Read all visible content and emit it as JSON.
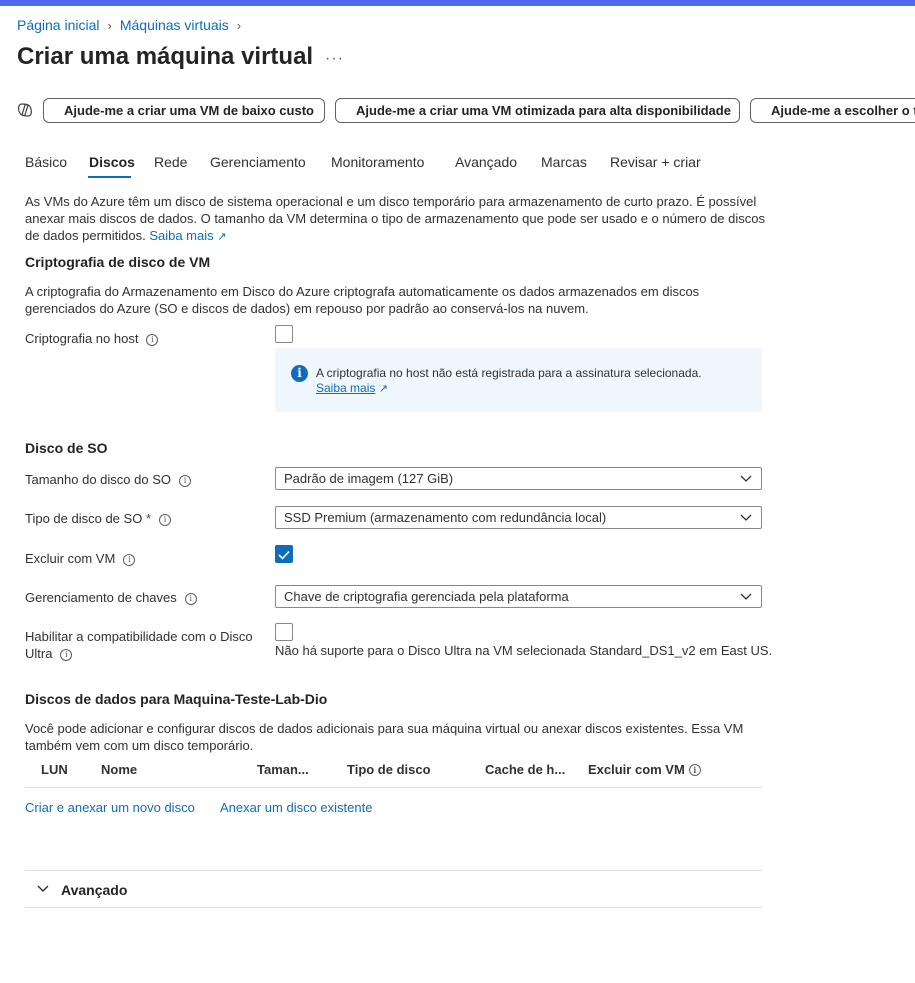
{
  "breadcrumb": {
    "home": "Página inicial",
    "vms": "Máquinas virtuais"
  },
  "title": "Criar uma máquina virtual",
  "more": "···",
  "prompts": [
    "Ajude-me a criar uma VM de baixo custo",
    "Ajude-me a criar uma VM otimizada para alta disponibilidade",
    "Ajude-me a escolher o tamanho"
  ],
  "tabs": [
    "Básico",
    "Discos",
    "Rede",
    "Gerenciamento",
    "Monitoramento",
    "Avançado",
    "Marcas",
    "Revisar + criar"
  ],
  "intro": {
    "text": "As VMs do Azure têm um disco de sistema operacional e um disco temporário para armazenamento de curto prazo. É possível anexar mais discos de dados. O tamanho da VM determina o tipo de armazenamento que pode ser usado e o número de discos de dados permitidos.",
    "link": "Saiba mais"
  },
  "encryption": {
    "heading": "Criptografia de disco de VM",
    "text": "A criptografia do Armazenamento em Disco do Azure criptografa automaticamente os dados armazenados em discos gerenciados do Azure (SO e discos de dados) em repouso por padrão ao conservá-los na nuvem.",
    "host_label": "Criptografia no host",
    "info_message": "A criptografia no host não está registrada para a assinatura selecionada.",
    "info_link": "Saiba mais"
  },
  "os_disk": {
    "heading": "Disco de SO",
    "size_label": "Tamanho do disco do SO",
    "size_value": "Padrão de imagem (127 GiB)",
    "type_label": "Tipo de disco de SO",
    "required_mark": "*",
    "type_value": "SSD Premium (armazenamento com redundância local)",
    "delete_label": "Excluir com VM",
    "delete_checked": true,
    "key_label": "Gerenciamento de chaves",
    "key_value": "Chave de criptografia gerenciada pela plataforma",
    "ultra_label_1": "Habilitar a compatibilidade com o Disco",
    "ultra_label_2": "Ultra",
    "ultra_note": "Não há suporte para o Disco Ultra na VM selecionada Standard_DS1_v2 em East US."
  },
  "data_disks": {
    "heading": "Discos de dados para Maquina-Teste-Lab-Dio",
    "text": "Você pode adicionar e configurar discos de dados adicionais para sua máquina virtual ou anexar discos existentes. Essa VM também vem com um disco temporário.",
    "columns": [
      "LUN",
      "Nome",
      "Taman...",
      "Tipo de disco",
      "Cache de h...",
      "Excluir com VM"
    ],
    "create_link": "Criar e anexar um novo disco",
    "attach_link": "Anexar um disco existente"
  },
  "advanced": "Avançado",
  "colors": {
    "accent": "#0f6cbd",
    "topbar": "#4f6bed",
    "info_bg": "#eff6fc"
  }
}
